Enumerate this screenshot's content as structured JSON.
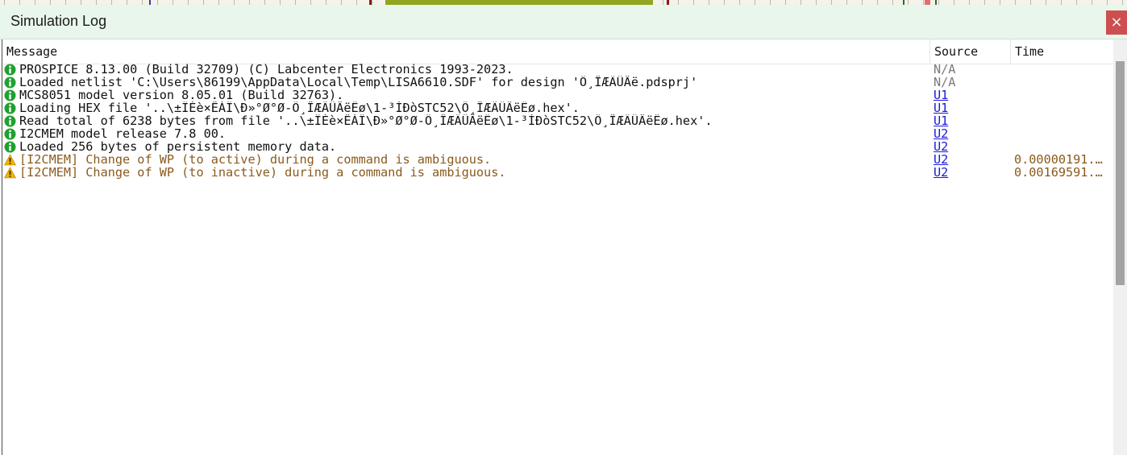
{
  "window": {
    "title": "Simulation Log",
    "close_glyph": "×"
  },
  "columns": {
    "message": "Message",
    "source": "Source",
    "time": "Time"
  },
  "icons": {
    "info": "info-icon",
    "warning": "warning-icon"
  },
  "colors": {
    "info": "#1fa12e",
    "warning": "#f0b400",
    "warning_text": "#8a5a1c",
    "link": "#1a1ad6",
    "close": "#cd4f4f"
  },
  "log": [
    {
      "level": "info",
      "message": "PROSPICE 8.13.00 (Build 32709) (C) Labcenter Electronics 1993-2023.",
      "source": "N/A",
      "source_link": false,
      "time": ""
    },
    {
      "level": "info",
      "message": "Loaded netlist 'C:\\Users\\86199\\AppData\\Local\\Temp\\LISA6610.SDF' for design 'Ö¸ÎÆÄÜÂë.pdsprj'",
      "source": "N/A",
      "source_link": false,
      "time": ""
    },
    {
      "level": "info",
      "message": "MCS8051 model version 8.05.01 (Build 32763).",
      "source": "U1",
      "source_link": true,
      "time": ""
    },
    {
      "level": "info",
      "message": "Loading HEX file '..\\±ÏÉè×ÊÁÏ\\Ð»°Ø°Ø-Ö¸ÎÆÄÜÂëËø\\1-³ÌÐòSTC52\\Ö¸ÎÆÄÜÂëËø.hex'.",
      "source": "U1",
      "source_link": true,
      "time": ""
    },
    {
      "level": "info",
      "message": "Read total of 6238 bytes from file '..\\±ÏÉè×ÊÁÏ\\Ð»°Ø°Ø-Ö¸ÎÆÄÜÂëËø\\1-³ÌÐòSTC52\\Ö¸ÎÆÄÜÂëËø.hex'.",
      "source": "U1",
      "source_link": true,
      "time": ""
    },
    {
      "level": "info",
      "message": "I2CMEM model release 7.8 00.",
      "source": "U2",
      "source_link": true,
      "time": ""
    },
    {
      "level": "info",
      "message": "Loaded 256 bytes of persistent memory data.",
      "source": "U2",
      "source_link": true,
      "time": ""
    },
    {
      "level": "warning",
      "message": "[I2CMEM] Change of WP (to active) during a command is ambiguous.",
      "source": "U2",
      "source_link": true,
      "time": "0.00000191..."
    },
    {
      "level": "warning",
      "message": "[I2CMEM] Change of WP (to inactive) during a command is ambiguous.",
      "source": "U2",
      "source_link": true,
      "time": "0.00169591..."
    }
  ]
}
